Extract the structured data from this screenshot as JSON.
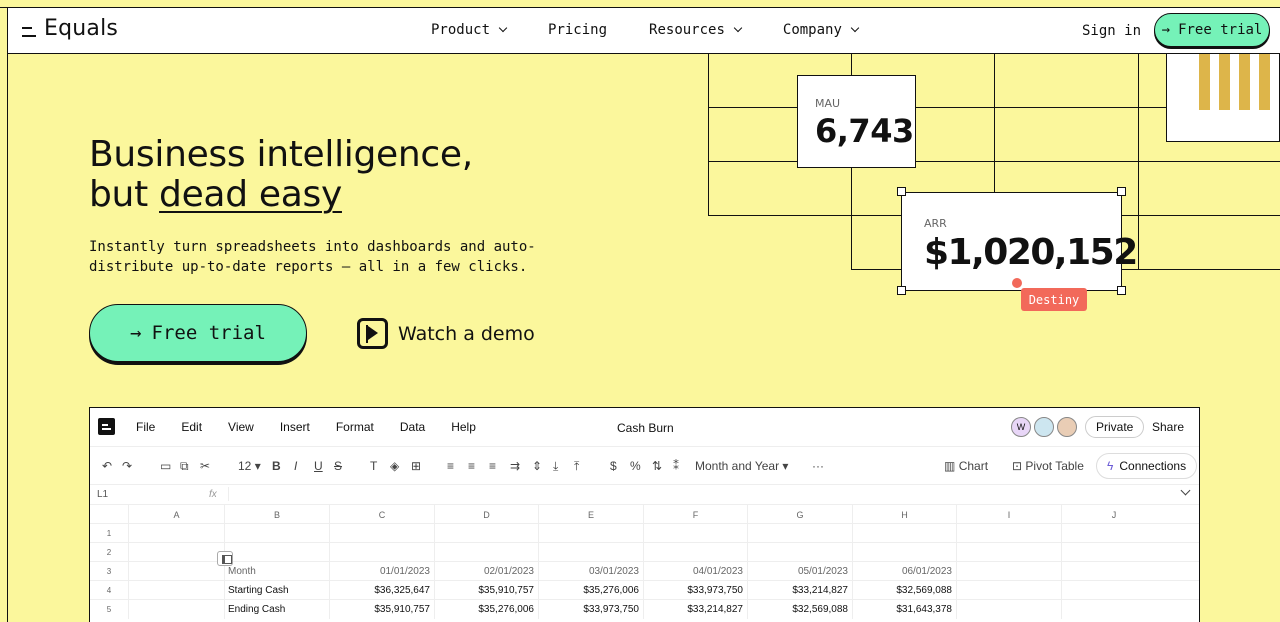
{
  "nav": {
    "brand": "Equals",
    "links": [
      "Product",
      "Pricing",
      "Resources",
      "Company"
    ],
    "sign_in": "Sign in",
    "cta": "Free trial"
  },
  "hero": {
    "title_line1": "Business intelligence,",
    "title_line2_prefix": "but ",
    "title_line2_underline": "dead easy",
    "subtitle_line1": "Instantly turn spreadsheets into dashboards and auto-",
    "subtitle_line2": "distribute up-to-date reports – all in a few clicks.",
    "cta": "Free trial",
    "watch": "Watch a demo"
  },
  "cards": {
    "mau_label": "MAU",
    "mau_value": "6,743",
    "arr_label": "ARR",
    "arr_value": "$1,020,152",
    "cursor_name": "Destiny"
  },
  "colors": {
    "background": "#fbf79c",
    "accent": "#75f2b8",
    "cursor": "#f2695a",
    "bars": "#ddb54a"
  },
  "sheet": {
    "menu": [
      "File",
      "Edit",
      "View",
      "Insert",
      "Format",
      "Data",
      "Help"
    ],
    "title": "Cash Burn",
    "avatar_letter": "W",
    "private": "Private",
    "share": "Share",
    "toolbar": {
      "font_size": "12",
      "date_format": "Month and Year",
      "more": "···",
      "chart": "Chart",
      "pivot": "Pivot Table",
      "connections": "Connections"
    },
    "cell_ref": "L1",
    "fx": "fx",
    "columns": [
      "A",
      "B",
      "C",
      "D",
      "E",
      "F",
      "G",
      "H",
      "I",
      "J"
    ],
    "row_numbers": [
      "1",
      "2",
      "3",
      "4",
      "5"
    ],
    "rows": [
      {
        "label": "",
        "values": [
          "",
          "",
          "",
          "",
          "",
          ""
        ]
      },
      {
        "label": "",
        "values": [
          "",
          "",
          "",
          "",
          "",
          ""
        ]
      },
      {
        "label": "Month",
        "values": [
          "01/01/2023",
          "02/01/2023",
          "03/01/2023",
          "04/01/2023",
          "05/01/2023",
          "06/01/2023"
        ]
      },
      {
        "label": "Starting Cash",
        "values": [
          "$36,325,647",
          "$35,910,757",
          "$35,276,006",
          "$33,973,750",
          "$33,214,827",
          "$32,569,088"
        ]
      },
      {
        "label": "Ending Cash",
        "values": [
          "$35,910,757",
          "$35,276,006",
          "$33,973,750",
          "$33,214,827",
          "$32,569,088",
          "$31,643,378"
        ]
      }
    ]
  }
}
